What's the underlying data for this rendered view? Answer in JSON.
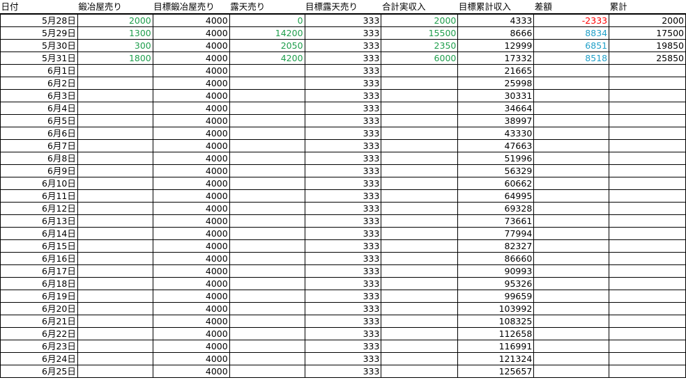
{
  "colors": {
    "green": "#1e9e4c",
    "red": "#ff0000",
    "cyan": "#21a0c8",
    "text": "#000000"
  },
  "headers": [
    "日付",
    "鍛冶屋売り",
    "目標鍛冶屋売り",
    "露天売り",
    "目標露天売り",
    "合計実収入",
    "目標累計収入",
    "差額",
    "累計"
  ],
  "rows": [
    [
      "5月28日",
      "2000",
      "4000",
      "0",
      "333",
      "2000",
      "4333",
      "-2333",
      "2000"
    ],
    [
      "5月29日",
      "1300",
      "4000",
      "14200",
      "333",
      "15500",
      "8666",
      "8834",
      "17500"
    ],
    [
      "5月30日",
      "300",
      "4000",
      "2050",
      "333",
      "2350",
      "12999",
      "6851",
      "19850"
    ],
    [
      "5月31日",
      "1800",
      "4000",
      "4200",
      "333",
      "6000",
      "17332",
      "8518",
      "25850"
    ],
    [
      "6月1日",
      "",
      "4000",
      "",
      "333",
      "",
      "21665",
      "",
      ""
    ],
    [
      "6月2日",
      "",
      "4000",
      "",
      "333",
      "",
      "25998",
      "",
      ""
    ],
    [
      "6月3日",
      "",
      "4000",
      "",
      "333",
      "",
      "30331",
      "",
      ""
    ],
    [
      "6月4日",
      "",
      "4000",
      "",
      "333",
      "",
      "34664",
      "",
      ""
    ],
    [
      "6月5日",
      "",
      "4000",
      "",
      "333",
      "",
      "38997",
      "",
      ""
    ],
    [
      "6月6日",
      "",
      "4000",
      "",
      "333",
      "",
      "43330",
      "",
      ""
    ],
    [
      "6月7日",
      "",
      "4000",
      "",
      "333",
      "",
      "47663",
      "",
      ""
    ],
    [
      "6月8日",
      "",
      "4000",
      "",
      "333",
      "",
      "51996",
      "",
      ""
    ],
    [
      "6月9日",
      "",
      "4000",
      "",
      "333",
      "",
      "56329",
      "",
      ""
    ],
    [
      "6月10日",
      "",
      "4000",
      "",
      "333",
      "",
      "60662",
      "",
      ""
    ],
    [
      "6月11日",
      "",
      "4000",
      "",
      "333",
      "",
      "64995",
      "",
      ""
    ],
    [
      "6月12日",
      "",
      "4000",
      "",
      "333",
      "",
      "69328",
      "",
      ""
    ],
    [
      "6月13日",
      "",
      "4000",
      "",
      "333",
      "",
      "73661",
      "",
      ""
    ],
    [
      "6月14日",
      "",
      "4000",
      "",
      "333",
      "",
      "77994",
      "",
      ""
    ],
    [
      "6月15日",
      "",
      "4000",
      "",
      "333",
      "",
      "82327",
      "",
      ""
    ],
    [
      "6月16日",
      "",
      "4000",
      "",
      "333",
      "",
      "86660",
      "",
      ""
    ],
    [
      "6月17日",
      "",
      "4000",
      "",
      "333",
      "",
      "90993",
      "",
      ""
    ],
    [
      "6月18日",
      "",
      "4000",
      "",
      "333",
      "",
      "95326",
      "",
      ""
    ],
    [
      "6月19日",
      "",
      "4000",
      "",
      "333",
      "",
      "99659",
      "",
      ""
    ],
    [
      "6月20日",
      "",
      "4000",
      "",
      "333",
      "",
      "103992",
      "",
      ""
    ],
    [
      "6月21日",
      "",
      "4000",
      "",
      "333",
      "",
      "108325",
      "",
      ""
    ],
    [
      "6月22日",
      "",
      "4000",
      "",
      "333",
      "",
      "112658",
      "",
      ""
    ],
    [
      "6月23日",
      "",
      "4000",
      "",
      "333",
      "",
      "116991",
      "",
      ""
    ],
    [
      "6月24日",
      "",
      "4000",
      "",
      "333",
      "",
      "121324",
      "",
      ""
    ],
    [
      "6月25日",
      "",
      "4000",
      "",
      "333",
      "",
      "125657",
      "",
      ""
    ]
  ]
}
